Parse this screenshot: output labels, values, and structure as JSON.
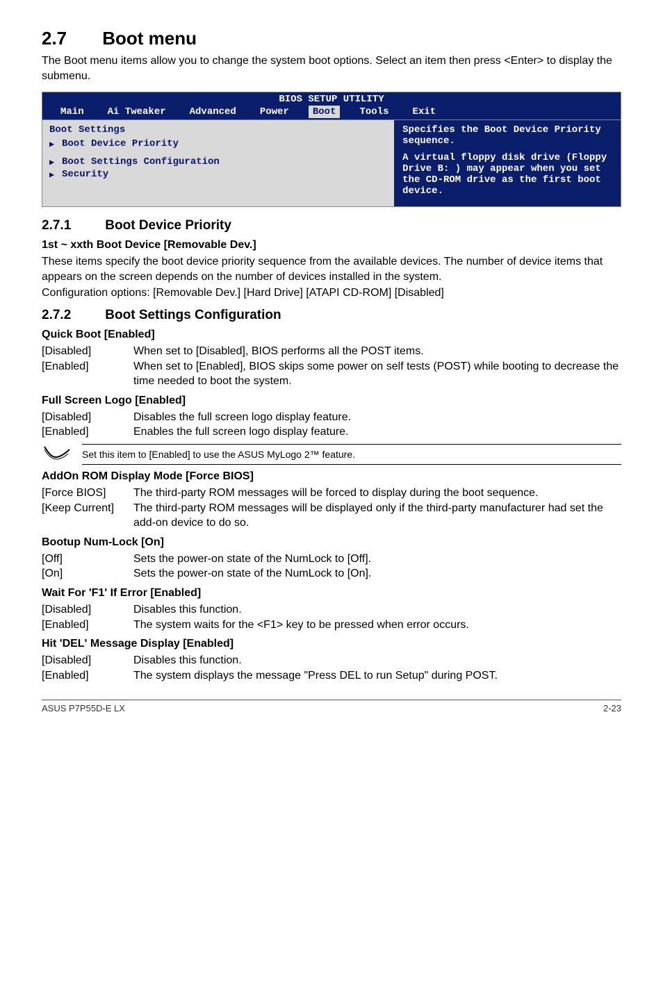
{
  "title": {
    "num": "2.7",
    "text": "Boot menu"
  },
  "intro": "The Boot menu items allow you to change the system boot options. Select an item then press <Enter> to display the submenu.",
  "bios": {
    "header": "BIOS SETUP UTILITY",
    "tabs": [
      "Main",
      "Ai Tweaker",
      "Advanced",
      "Power",
      "Boot",
      "Tools",
      "Exit"
    ],
    "left_heading": "Boot Settings",
    "left_items": [
      "Boot Device Priority",
      "Boot Settings Configuration",
      "Security"
    ],
    "right_top": "Specifies the Boot Device Priority sequence.",
    "right_bottom": "A virtual floppy disk drive (Floppy Drive B: ) may appear when you set the CD-ROM drive as the first boot device."
  },
  "s271": {
    "num": "2.7.1",
    "title": "Boot Device Priority",
    "heading": "1st ~ xxth Boot Device [Removable Dev.]",
    "p1": "These items specify the boot device priority sequence from the available devices. The number of device items that appears on the screen depends on the number of devices installed in the system.",
    "p2": "Configuration options: [Removable Dev.] [Hard Drive] [ATAPI CD-ROM] [Disabled]"
  },
  "s272": {
    "num": "2.7.2",
    "title": "Boot Settings Configuration",
    "quick": {
      "heading": "Quick Boot [Enabled]",
      "rows": [
        {
          "k": "[Disabled]",
          "v": "When set to [Disabled], BIOS performs all the POST items."
        },
        {
          "k": "[Enabled]",
          "v": "When set to [Enabled], BIOS skips some power on self tests (POST) while booting to decrease the time needed to boot the system."
        }
      ]
    },
    "full": {
      "heading": "Full Screen Logo [Enabled]",
      "rows": [
        {
          "k": "[Disabled]",
          "v": "Disables the full screen logo display feature."
        },
        {
          "k": "[Enabled]",
          "v": "Enables the full screen logo display feature."
        }
      ],
      "note": "Set this item to [Enabled] to use the ASUS MyLogo 2™ feature."
    },
    "addon": {
      "heading": "AddOn ROM Display Mode [Force BIOS]",
      "rows": [
        {
          "k": "[Force BIOS]",
          "v": "The third-party ROM messages will be forced to display during the boot sequence."
        },
        {
          "k": "[Keep Current]",
          "v": "The third-party ROM messages will be displayed only if the third-party manufacturer had set the add-on device to do so."
        }
      ]
    },
    "numlock": {
      "heading": "Bootup Num-Lock [On]",
      "rows": [
        {
          "k": "[Off]",
          "v": "Sets the power-on state of the NumLock to [Off]."
        },
        {
          "k": "[On]",
          "v": "Sets the power-on state of the NumLock to [On]."
        }
      ]
    },
    "waitf1": {
      "heading": "Wait For 'F1' If Error [Enabled]",
      "rows": [
        {
          "k": "[Disabled]",
          "v": "Disables this function."
        },
        {
          "k": "[Enabled]",
          "v": "The system waits for the <F1> key to be pressed when error occurs."
        }
      ]
    },
    "hitdel": {
      "heading": "Hit 'DEL' Message Display [Enabled]",
      "rows": [
        {
          "k": "[Disabled]",
          "v": "Disables this function."
        },
        {
          "k": "[Enabled]",
          "v": "The system displays the message \"Press DEL to run Setup\" during POST."
        }
      ]
    }
  },
  "footer": {
    "left": "ASUS P7P55D-E LX",
    "right": "2-23"
  }
}
